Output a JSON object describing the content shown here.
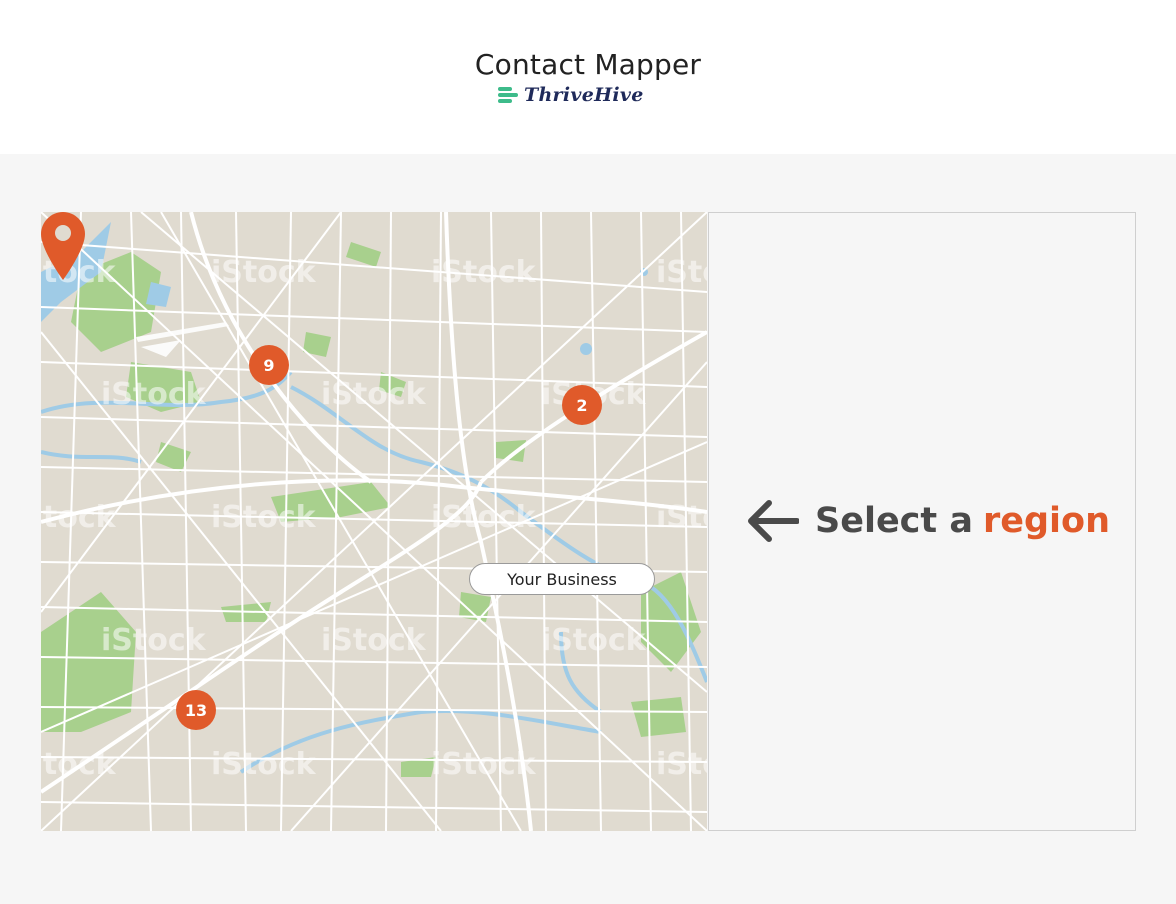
{
  "header": {
    "title": "Contact Mapper",
    "brand_name": "ThriveHive",
    "brand_icon": "thrivehive-logo-icon",
    "brand_color": "#3dbb8a"
  },
  "map": {
    "clusters": [
      {
        "label": "9"
      },
      {
        "label": "2"
      },
      {
        "label": "13"
      }
    ],
    "business": {
      "label": "Your Business",
      "icon": "map-pin-icon"
    },
    "watermark": "iStock",
    "colors": {
      "land": "#e0dbd0",
      "roads": "#ffffff",
      "parks": "#a8d08d",
      "water": "#9fcbe6",
      "marker": "#e05a2a"
    }
  },
  "panel": {
    "arrow_icon": "arrow-left-icon",
    "prompt_text": "Select a",
    "prompt_highlight": "region"
  }
}
